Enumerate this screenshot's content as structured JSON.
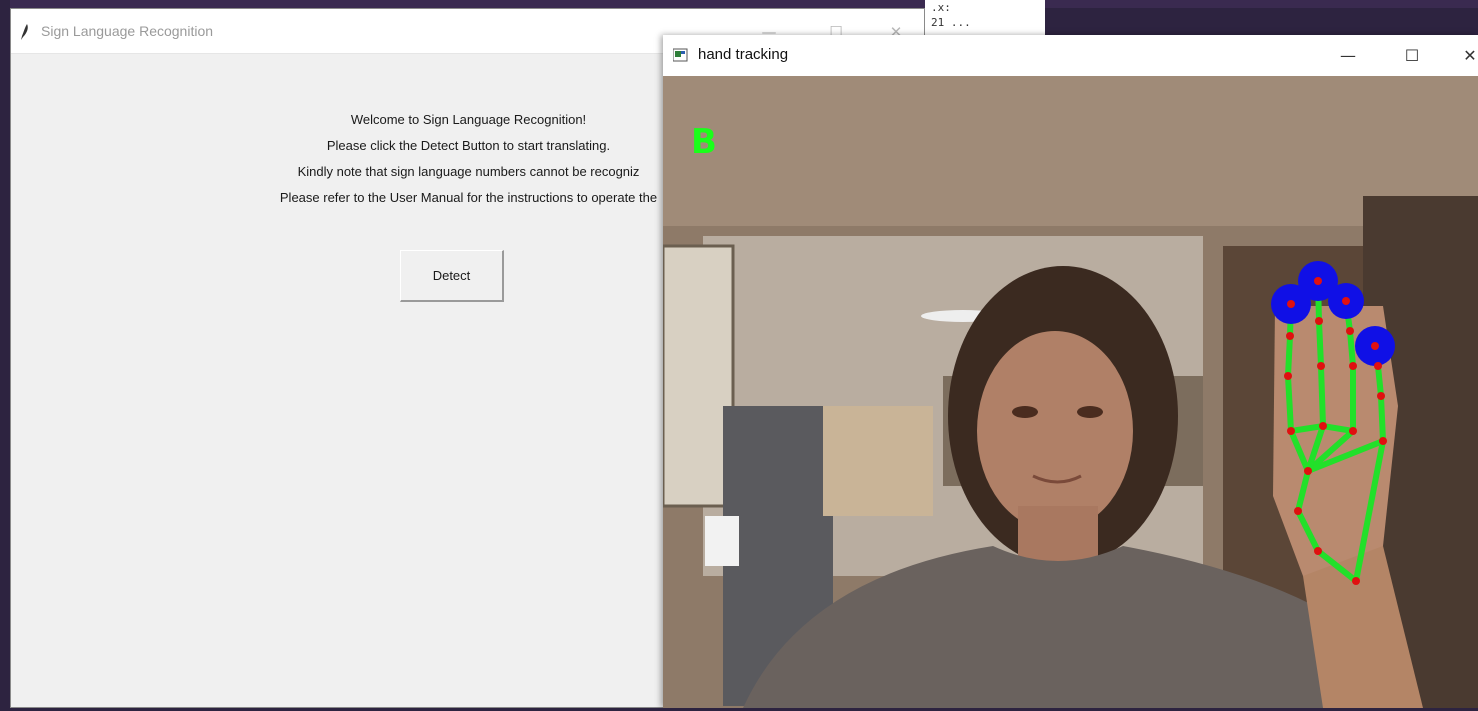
{
  "tk_window": {
    "title": "Sign Language Recognition",
    "controls": {
      "minimize": "—",
      "maximize": "☐",
      "close": "✕"
    },
    "lines": [
      "Welcome to Sign Language Recognition!",
      "Please click the Detect Button to start translating.",
      "Kindly note that sign language numbers cannot be recogniz",
      "Please refer to the User Manual for the instructions to operate the"
    ],
    "detect_label": "Detect"
  },
  "console": {
    "line1": ".x:",
    "line2": "21 ..."
  },
  "cv_window": {
    "title": "hand tracking",
    "controls": {
      "minimize": "—",
      "maximize": "☐",
      "close": "✕"
    },
    "detected_sign": "B"
  },
  "colors": {
    "landmark_line": "#22e02a",
    "landmark_point": "#e01010",
    "fingertip": "#1010e6",
    "label": "#1aff1a"
  },
  "icons": {
    "tk_window": "feather-icon",
    "cv_window": "opencv-window-icon"
  }
}
